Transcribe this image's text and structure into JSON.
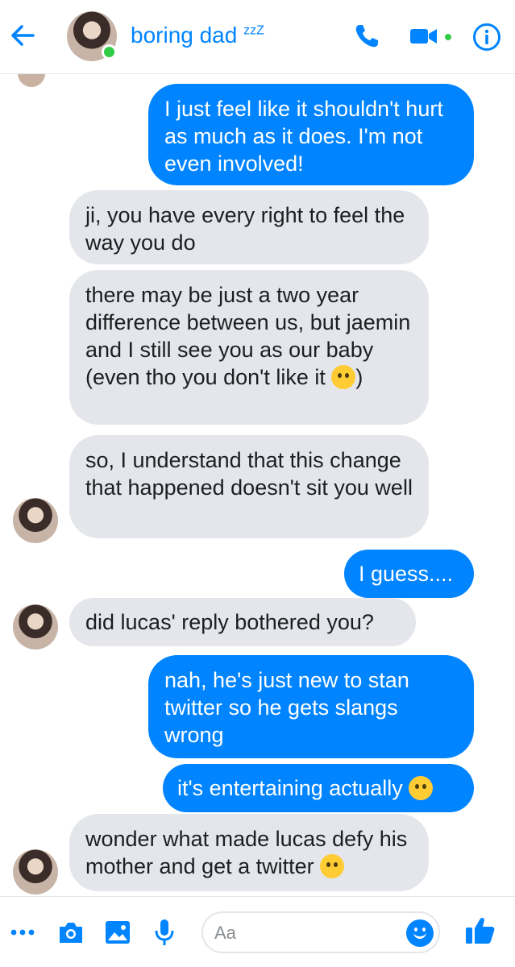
{
  "header": {
    "contact_name": "boring dad",
    "contact_suffix": "zzZ",
    "accent_color": "#0084ff",
    "online_color": "#31cc46",
    "icons": [
      "back-arrow-icon",
      "phone-icon",
      "video-camera-icon",
      "info-icon"
    ]
  },
  "messages": [
    {
      "sender": "me",
      "text": "I just feel like it shouldn't hurt as much as it does. I'm not even involved!"
    },
    {
      "sender": "them",
      "text": "ji, you have every right to feel the way you do"
    },
    {
      "sender": "them",
      "text": "there may be just a two year difference between us, but jaemin and I still see you as our baby (even tho you don't like it",
      "emoji": "face-with-rolling-eyes",
      "tail": ")"
    },
    {
      "sender": "them",
      "text": "so, I understand that this change that happened doesn't sit you well"
    },
    {
      "sender": "me",
      "text": "I guess...."
    },
    {
      "sender": "them",
      "text": "did lucas' reply bothered you?"
    },
    {
      "sender": "me",
      "text": "nah, he's just new to stan twitter so he gets slangs wrong"
    },
    {
      "sender": "me",
      "text": "it's entertaining actually",
      "emoji": "zany-face"
    },
    {
      "sender": "them",
      "text": "wonder what made lucas defy his mother and get a twitter",
      "emoji": "grinning-squinting-face"
    }
  ],
  "composer": {
    "placeholder": "Aa",
    "icons": [
      "more-icon",
      "camera-icon",
      "gallery-icon",
      "microphone-icon",
      "emoji-icon",
      "thumbs-up-icon"
    ]
  }
}
